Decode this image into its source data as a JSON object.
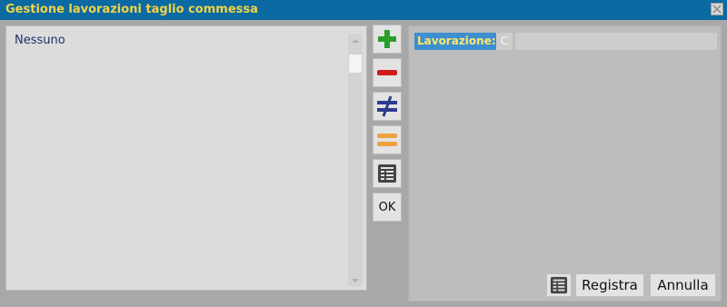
{
  "window": {
    "title": "Gestione lavorazioni taglio commessa",
    "accent_color": "#0a6aa1",
    "title_color": "#f3d24a"
  },
  "list": {
    "items": [
      "Nessuno"
    ]
  },
  "toolbar": {
    "buttons": [
      {
        "icon": "plus-icon",
        "color": "#2a9d2a"
      },
      {
        "icon": "minus-icon",
        "color": "#d11a1a"
      },
      {
        "icon": "not-equal-icon",
        "color": "#2b3d8c"
      },
      {
        "icon": "equal-icon",
        "color": "#f0a040"
      },
      {
        "icon": "table-icon",
        "color": "#444444"
      }
    ],
    "ok_label": "OK"
  },
  "form": {
    "lavorazione_label": "Lavorazione:",
    "lavorazione_code": "C",
    "lavorazione_value": ""
  },
  "actions": {
    "grid_icon": "table-icon",
    "registra_label": "Registra",
    "annulla_label": "Annulla"
  }
}
